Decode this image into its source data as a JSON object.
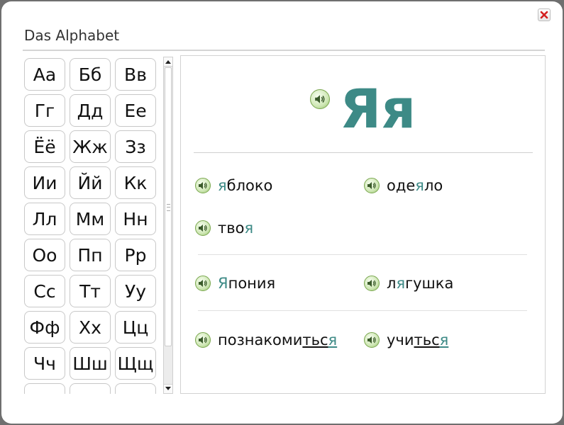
{
  "dialog": {
    "title": "Das Alphabet",
    "close_icon": "close-x-icon",
    "close_color": "#d42020"
  },
  "alphabet": {
    "letters": [
      "Аа",
      "Бб",
      "Вв",
      "Гг",
      "Дд",
      "Ее",
      "Ёё",
      "Жж",
      "Зз",
      "Ии",
      "Йй",
      "Кк",
      "Лл",
      "Мм",
      "Нн",
      "Оо",
      "Пп",
      "Рр",
      "Сс",
      "Тт",
      "Уу",
      "Фф",
      "Хх",
      "Цц",
      "Чч",
      "Шш",
      "Щщ",
      "",
      "",
      ""
    ]
  },
  "detail": {
    "letter": "Яя",
    "accent_color": "#3d8a86",
    "speaker_icon": "speaker-icon",
    "words": [
      {
        "parts": [
          {
            "t": "я",
            "s": "hl"
          },
          {
            "t": "блоко",
            "s": ""
          }
        ]
      },
      {
        "parts": [
          {
            "t": "оде",
            "s": ""
          },
          {
            "t": "я",
            "s": "hl"
          },
          {
            "t": "ло",
            "s": ""
          }
        ]
      },
      {
        "parts": [
          {
            "t": "тво",
            "s": ""
          },
          {
            "t": "я",
            "s": "hl"
          }
        ]
      },
      {
        "parts": [
          {
            "t": "Я",
            "s": "hl"
          },
          {
            "t": "пония",
            "s": ""
          }
        ]
      },
      {
        "parts": [
          {
            "t": "л",
            "s": ""
          },
          {
            "t": "я",
            "s": "hl"
          },
          {
            "t": "гушка",
            "s": ""
          }
        ]
      },
      {
        "parts": [
          {
            "t": "познакоми",
            "s": ""
          },
          {
            "t": "тьс",
            "s": "ul"
          },
          {
            "t": "я",
            "s": "hl ul"
          }
        ]
      },
      {
        "parts": [
          {
            "t": "учи",
            "s": ""
          },
          {
            "t": "тьс",
            "s": "ul"
          },
          {
            "t": "я",
            "s": "hl ul"
          }
        ]
      }
    ]
  }
}
